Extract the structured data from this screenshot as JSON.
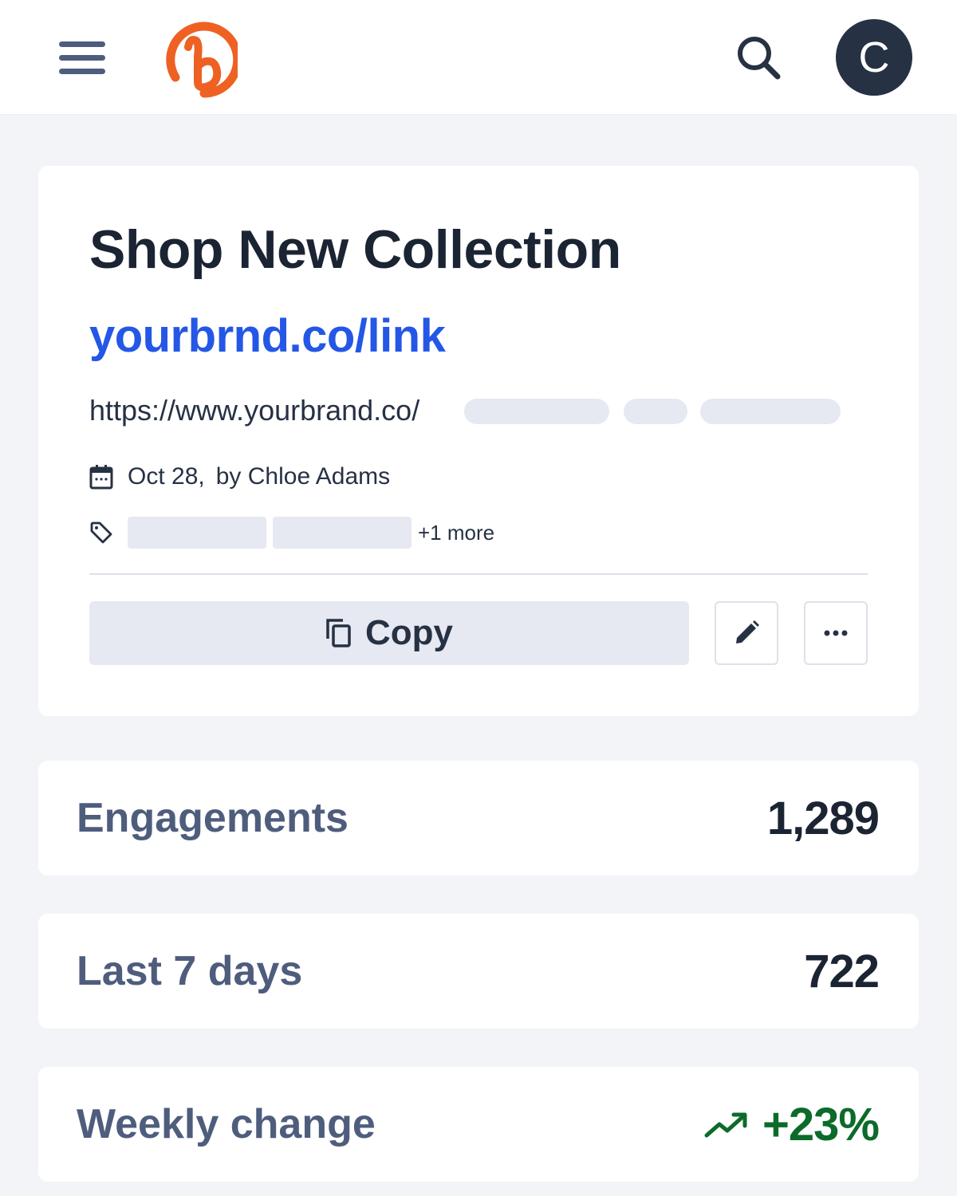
{
  "header": {
    "menu_icon": "hamburger-menu-icon",
    "logo_icon": "bitly-logo",
    "search_icon": "search-icon",
    "avatar_initial": "C"
  },
  "link": {
    "title": "Shop New Collection",
    "short_url": "yourbrnd.co/link",
    "long_url": "https://www.yourbrand.co/",
    "date": "Oct 28,",
    "author": "by Chloe Adams",
    "tags_more": "+1 more",
    "copy_label": "Copy",
    "edit_icon": "pencil-icon",
    "more_icon": "more-horizontal-icon"
  },
  "stats": [
    {
      "label": "Engagements",
      "value": "1,289"
    },
    {
      "label": "Last 7 days",
      "value": "722"
    },
    {
      "label": "Weekly change",
      "value": "+23%",
      "trend": "up",
      "trend_color": "#0c6b2a"
    }
  ],
  "colors": {
    "brand": "#ee6123",
    "link": "#2457e6",
    "positive": "#0c6b2a"
  }
}
